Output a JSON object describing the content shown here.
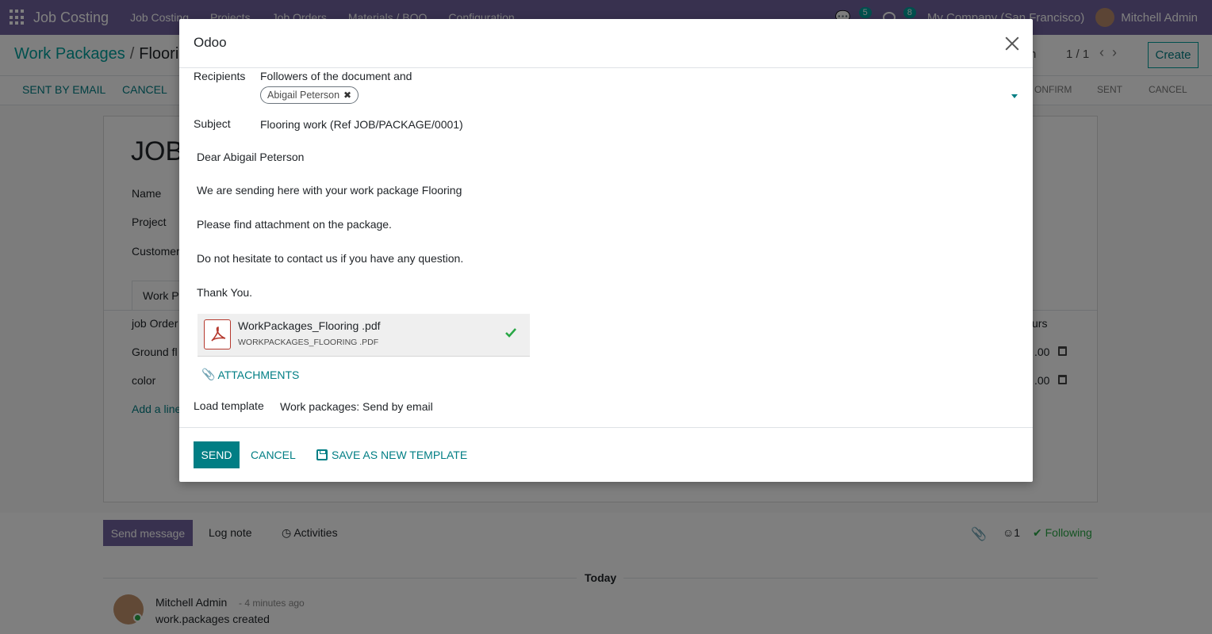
{
  "app": {
    "brand": "Job Costing",
    "menu": [
      "Job Costing",
      "Projects",
      "Job Orders",
      "Materials / BOQ",
      "Configuration"
    ],
    "messages_count": "5",
    "activities_count": "8",
    "company": "My Company (San Francisco)",
    "user": "Mitchell Admin"
  },
  "control_panel": {
    "breadcrumb_parent": "Work Packages",
    "breadcrumb_current": "Floori",
    "pager": "1 / 1",
    "create_label": "Create",
    "partial_left": "n"
  },
  "status_bar": {
    "buttons": [
      "SENT BY EMAIL",
      "CANCEL"
    ],
    "stages": [
      "ONFIRM",
      "SENT",
      "CANCEL"
    ]
  },
  "form": {
    "title": "JOB",
    "name_label": "Name",
    "project_label": "Project",
    "customer_label": "Customer",
    "tab_label": "Work P",
    "col_job_order": "job Order",
    "col_hours": "urs",
    "rows": [
      {
        "name": "Ground fl",
        "hours": ".00"
      },
      {
        "name": "color",
        "hours": ".00"
      }
    ],
    "add_line": "Add a line"
  },
  "chatter": {
    "send_message": "Send message",
    "log_note": "Log note",
    "activities": "Activities",
    "followers_count": "1",
    "following": "Following",
    "today": "Today",
    "author": "Mitchell Admin",
    "time": "- 4 minutes ago",
    "message": "work.packages created"
  },
  "modal": {
    "title": "Odoo",
    "recipients_label": "Recipients",
    "recipients_text": "Followers of the document and",
    "recipient_tag": "Abigail Peterson",
    "subject_label": "Subject",
    "subject_value": "Flooring work (Ref JOB/PACKAGE/0001)",
    "body": [
      "Dear Abigail Peterson",
      "We are sending here with your work package Flooring",
      "Please find attachment on the package.",
      "Do not hesitate to contact us if you have any question.",
      "Thank You."
    ],
    "attachment_name": "WorkPackages_Flooring .pdf",
    "attachment_sub": "WORKPACKAGES_FLOORING .PDF",
    "attachments_link": "ATTACHMENTS",
    "load_template_label": "Load template",
    "load_template_value": "Work packages: Send by email",
    "send_label": "SEND",
    "cancel_label": "CANCEL",
    "save_template_label": "SAVE AS NEW TEMPLATE"
  },
  "colors": {
    "navbar": "#71639e",
    "accent": "#017e84",
    "overlay": "rgba(0,0,0,0.5)"
  }
}
